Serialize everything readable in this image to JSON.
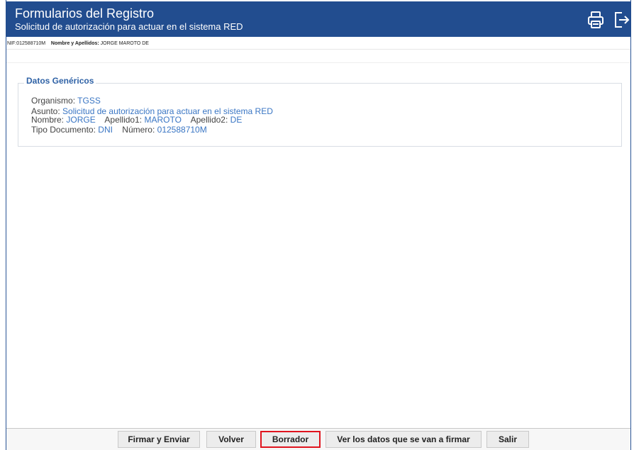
{
  "header": {
    "title": "Formularios del Registro",
    "subtitle": "Solicitud de autorización para actuar en el sistema RED",
    "print_icon": "printer-icon",
    "exit_icon": "logout-icon"
  },
  "infobar": {
    "nif_label": "NIF:",
    "nif_value": "012588710M",
    "name_label": "Nombre y Apellidos:",
    "name_value": "JORGE MAROTO DE"
  },
  "datos": {
    "legend": "Datos Genéricos",
    "organismo_label": "Organismo:",
    "organismo_value": "TGSS",
    "asunto_label": "Asunto:",
    "asunto_value": "Solicitud de autorización para actuar en el sistema RED",
    "nombre_label": "Nombre:",
    "nombre_value": "JORGE",
    "apellido1_label": "Apellido1:",
    "apellido1_value": "MAROTO",
    "apellido2_label": "Apellido2:",
    "apellido2_value": "DE",
    "tipodoc_label": "Tipo Documento:",
    "tipodoc_value": "DNI",
    "numero_label": "Número:",
    "numero_value": "012588710M"
  },
  "footer": {
    "firmar_label": "Firmar y Enviar",
    "volver_label": "Volver",
    "borrador_label": "Borrador",
    "ver_label": "Ver los datos que se van a firmar",
    "salir_label": "Salir"
  },
  "colors": {
    "header_bg": "#224d8f",
    "value_text": "#3a76c4",
    "highlight_border": "#e0141e"
  }
}
